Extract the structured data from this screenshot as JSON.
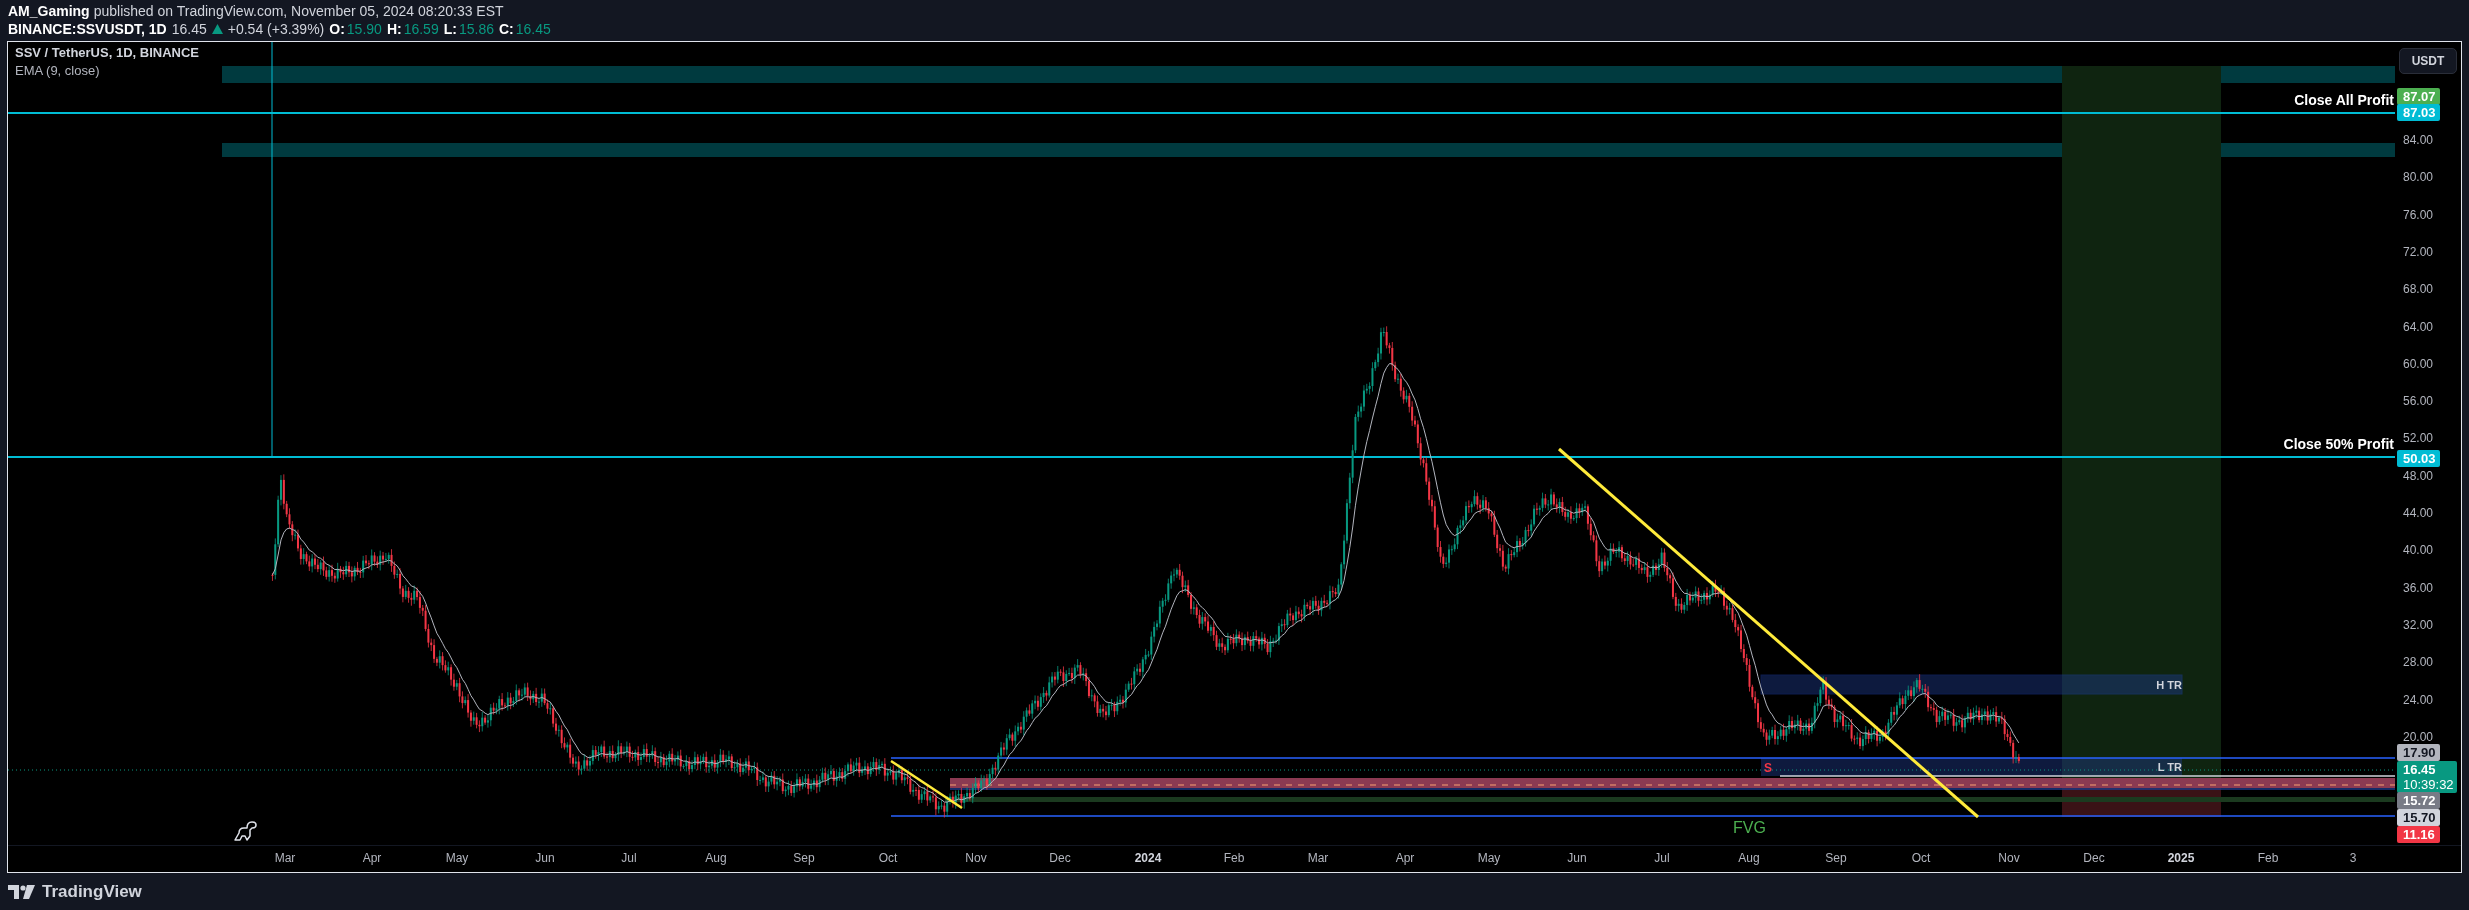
{
  "header": {
    "author": "AM_Gaming",
    "published": "published on TradingView.com, November 05, 2024 08:20:33 EST"
  },
  "symbol_bar": {
    "symbol": "BINANCE:SSVUSDT, 1D",
    "price": "16.45",
    "rising": true,
    "change": "+0.54 (+3.39%)",
    "ohlc": [
      {
        "label": "O:",
        "value": "15.90"
      },
      {
        "label": "H:",
        "value": "16.59"
      },
      {
        "label": "L:",
        "value": "15.86"
      },
      {
        "label": "C:",
        "value": "16.45"
      }
    ]
  },
  "legend": {
    "title": "SSV / TetherUS, 1D, BINANCE",
    "indicator": "EMA (9, close)"
  },
  "drawings": {
    "close_all_label": "Close All Profit",
    "close_half_label": "Close 50% Profit",
    "high_range_label": "H TR",
    "low_range_label": "L TR",
    "fvg_label": "FVG",
    "marker": "S"
  },
  "price_axis": {
    "currency_button": "USDT",
    "ticks": [
      "84.00",
      "80.00",
      "76.00",
      "72.00",
      "68.00",
      "64.00",
      "60.00",
      "56.00",
      "52.00",
      "48.00",
      "44.00",
      "40.00",
      "36.00",
      "32.00",
      "28.00",
      "24.00",
      "20.00"
    ],
    "badges": [
      {
        "text": "87.07",
        "color": "#4caf50"
      },
      {
        "text": "87.03",
        "color": "#00bcd4"
      },
      {
        "text": "50.03",
        "color": "#00bcd4"
      },
      {
        "text": "17.90",
        "color": "#b2b5be"
      },
      {
        "text": "16.45",
        "subtext": "10:39:32",
        "color": "#089981"
      },
      {
        "text": "15.72",
        "color": "#787b86"
      },
      {
        "text": "15.70",
        "color": "#d1d4dc"
      },
      {
        "text": "11.16",
        "color": "#f23645"
      }
    ]
  },
  "time_axis": {
    "labels": [
      {
        "label": "Mar",
        "bold": false
      },
      {
        "label": "Apr",
        "bold": false
      },
      {
        "label": "May",
        "bold": false
      },
      {
        "label": "Jun",
        "bold": false
      },
      {
        "label": "Jul",
        "bold": false
      },
      {
        "label": "Aug",
        "bold": false
      },
      {
        "label": "Sep",
        "bold": false
      },
      {
        "label": "Oct",
        "bold": false
      },
      {
        "label": "Nov",
        "bold": false
      },
      {
        "label": "Dec",
        "bold": false
      },
      {
        "label": "2024",
        "bold": true
      },
      {
        "label": "Feb",
        "bold": false
      },
      {
        "label": "Mar",
        "bold": false
      },
      {
        "label": "Apr",
        "bold": false
      },
      {
        "label": "May",
        "bold": false
      },
      {
        "label": "Jun",
        "bold": false
      },
      {
        "label": "Jul",
        "bold": false
      },
      {
        "label": "Aug",
        "bold": false
      },
      {
        "label": "Sep",
        "bold": false
      },
      {
        "label": "Oct",
        "bold": false
      },
      {
        "label": "Nov",
        "bold": false
      },
      {
        "label": "Dec",
        "bold": false
      },
      {
        "label": "2025",
        "bold": true
      },
      {
        "label": "Feb",
        "bold": false
      },
      {
        "label": "3",
        "bold": false
      }
    ]
  },
  "footer": {
    "brand": "TradingView"
  }
}
